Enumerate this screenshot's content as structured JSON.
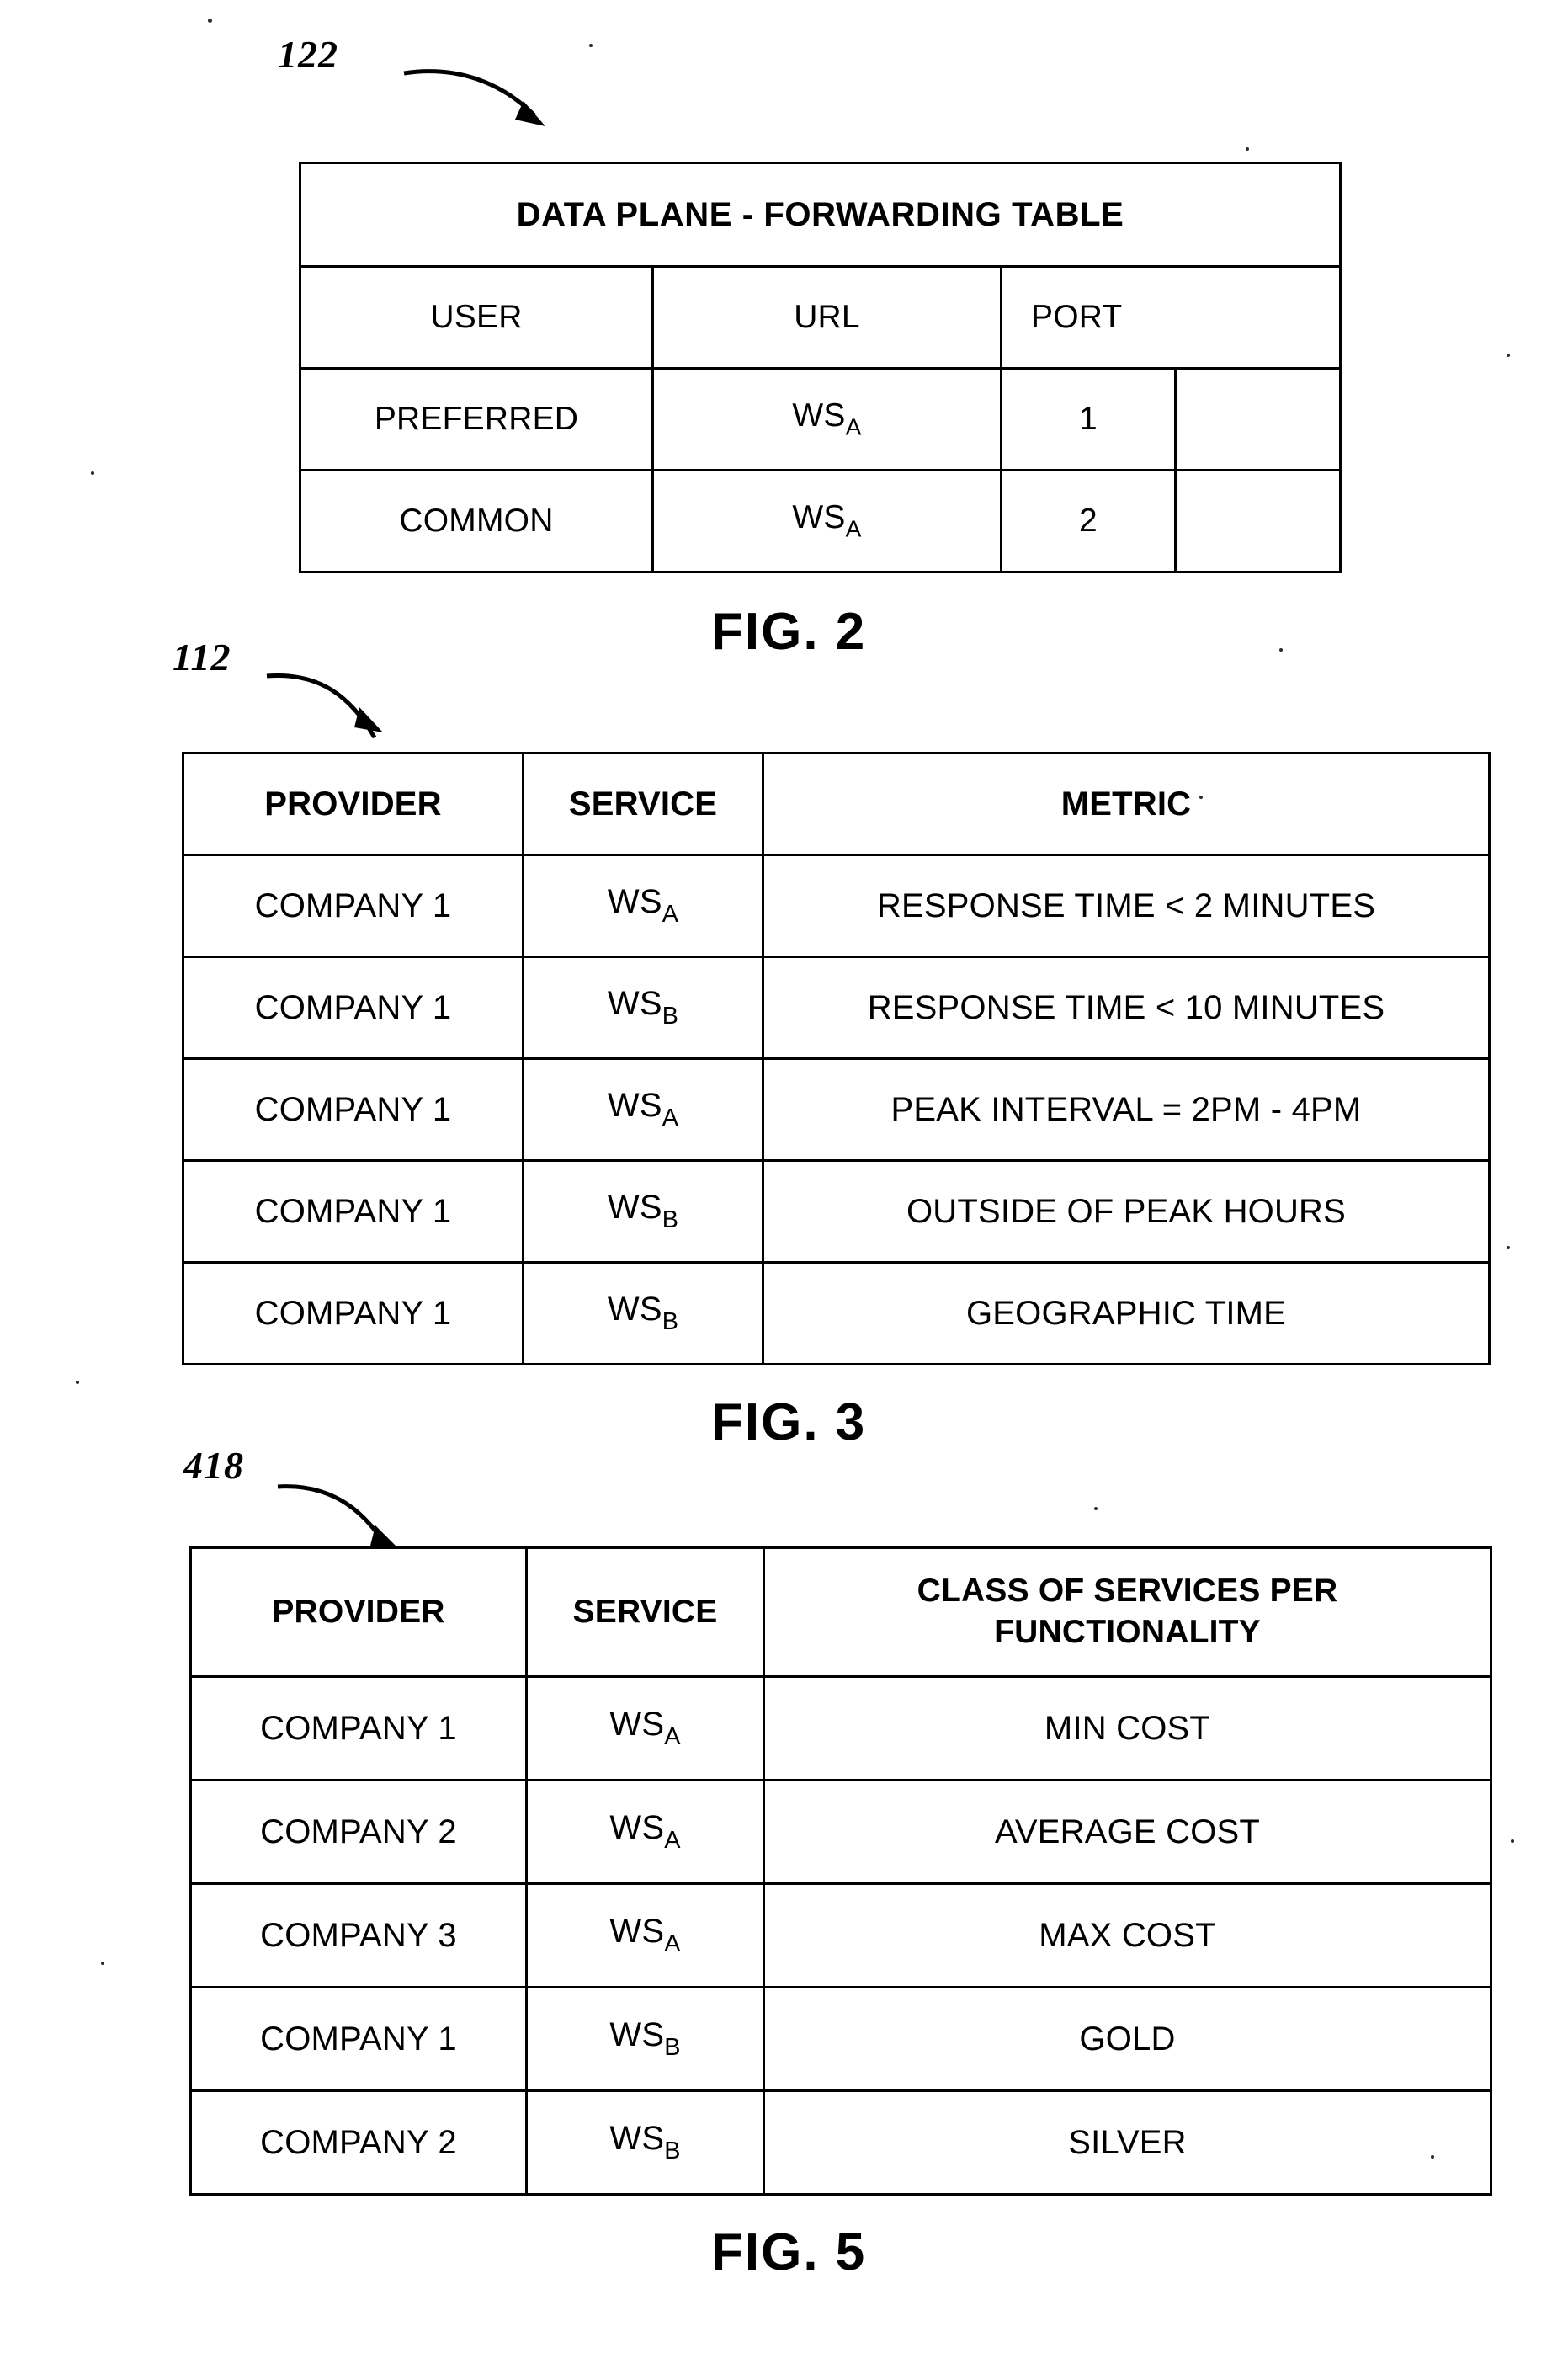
{
  "figures": [
    {
      "id": "fig2",
      "reference_number": "122",
      "caption": "FIG. 2",
      "title_row": "DATA PLANE - FORWARDING TABLE",
      "columns": [
        "USER",
        "URL",
        "PORT"
      ],
      "rows": [
        {
          "user": "PREFERRED",
          "url_base": "WS",
          "url_sub": "A",
          "port": "1",
          "extra": ""
        },
        {
          "user": "COMMON",
          "url_base": "WS",
          "url_sub": "A",
          "port": "2",
          "extra": ""
        }
      ]
    },
    {
      "id": "fig3",
      "reference_number": "112",
      "caption": "FIG. 3",
      "columns": [
        "PROVIDER",
        "SERVICE",
        "METRIC"
      ],
      "rows": [
        {
          "provider": "COMPANY 1",
          "service_base": "WS",
          "service_sub": "A",
          "metric": "RESPONSE TIME < 2 MINUTES"
        },
        {
          "provider": "COMPANY 1",
          "service_base": "WS",
          "service_sub": "B",
          "metric": "RESPONSE TIME < 10 MINUTES"
        },
        {
          "provider": "COMPANY 1",
          "service_base": "WS",
          "service_sub": "A",
          "metric": "PEAK INTERVAL = 2PM - 4PM"
        },
        {
          "provider": "COMPANY 1",
          "service_base": "WS",
          "service_sub": "B",
          "metric": "OUTSIDE OF PEAK HOURS"
        },
        {
          "provider": "COMPANY 1",
          "service_base": "WS",
          "service_sub": "B",
          "metric": "GEOGRAPHIC TIME"
        }
      ]
    },
    {
      "id": "fig5",
      "reference_number": "418",
      "caption": "FIG. 5",
      "columns": [
        "PROVIDER",
        "SERVICE",
        "CLASS OF SERVICES PER FUNCTIONALITY"
      ],
      "column3_line1": "CLASS OF SERVICES PER",
      "column3_line2": "FUNCTIONALITY",
      "rows": [
        {
          "provider": "COMPANY 1",
          "service_base": "WS",
          "service_sub": "A",
          "class": "MIN COST"
        },
        {
          "provider": "COMPANY 2",
          "service_base": "WS",
          "service_sub": "A",
          "class": "AVERAGE COST"
        },
        {
          "provider": "COMPANY 3",
          "service_base": "WS",
          "service_sub": "A",
          "class": "MAX COST"
        },
        {
          "provider": "COMPANY 1",
          "service_base": "WS",
          "service_sub": "B",
          "class": "GOLD"
        },
        {
          "provider": "COMPANY 2",
          "service_base": "WS",
          "service_sub": "B",
          "class": "SILVER"
        }
      ]
    }
  ],
  "colors": {
    "ink": "#000000",
    "page": "#ffffff"
  }
}
